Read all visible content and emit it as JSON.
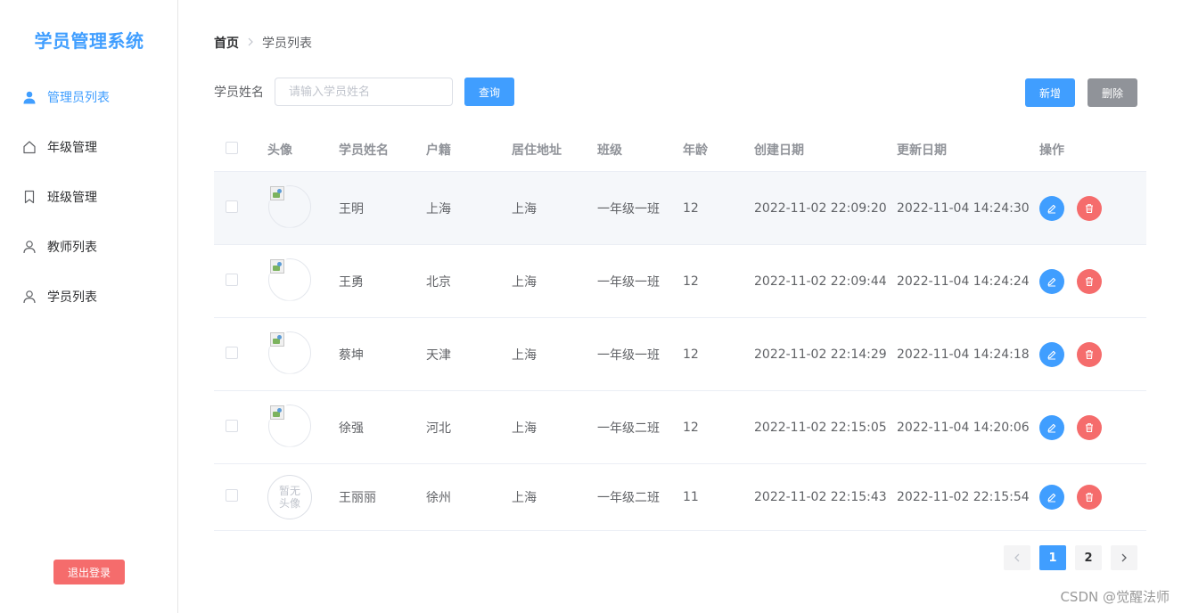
{
  "app": {
    "title": "学员管理系统"
  },
  "sidebar": {
    "items": [
      {
        "label": "管理员列表",
        "icon": "user-filled-icon",
        "active": true
      },
      {
        "label": "年级管理",
        "icon": "house-icon",
        "active": false
      },
      {
        "label": "班级管理",
        "icon": "bookmark-icon",
        "active": false
      },
      {
        "label": "教师列表",
        "icon": "user-icon",
        "active": false
      },
      {
        "label": "学员列表",
        "icon": "user-icon",
        "active": false
      }
    ],
    "logout_label": "退出登录"
  },
  "breadcrumb": {
    "home": "首页",
    "current": "学员列表"
  },
  "search": {
    "label": "学员姓名",
    "placeholder": "请输入学员姓名",
    "value": "",
    "query_label": "查询"
  },
  "toolbar": {
    "add_label": "新增",
    "delete_label": "删除"
  },
  "table": {
    "headers": {
      "avatar": "头像",
      "name": "学员姓名",
      "hometown": "户籍",
      "address": "居住地址",
      "class": "班级",
      "age": "年龄",
      "created": "创建日期",
      "updated": "更新日期",
      "actions": "操作"
    },
    "rows": [
      {
        "name": "王明",
        "hometown": "上海",
        "address": "上海",
        "class": "一年级一班",
        "age": "12",
        "created": "2022-11-02 22:09:20",
        "updated": "2022-11-04 14:24:30",
        "avatar": "broken-image",
        "avatar_text": ""
      },
      {
        "name": "王勇",
        "hometown": "北京",
        "address": "上海",
        "class": "一年级一班",
        "age": "12",
        "created": "2022-11-02 22:09:44",
        "updated": "2022-11-04 14:24:24",
        "avatar": "broken-image",
        "avatar_text": ""
      },
      {
        "name": "蔡坤",
        "hometown": "天津",
        "address": "上海",
        "class": "一年级一班",
        "age": "12",
        "created": "2022-11-02 22:14:29",
        "updated": "2022-11-04 14:24:18",
        "avatar": "broken-image",
        "avatar_text": ""
      },
      {
        "name": "徐强",
        "hometown": "河北",
        "address": "上海",
        "class": "一年级二班",
        "age": "12",
        "created": "2022-11-02 22:15:05",
        "updated": "2022-11-04 14:20:06",
        "avatar": "broken-image",
        "avatar_text": ""
      },
      {
        "name": "王丽丽",
        "hometown": "徐州",
        "address": "上海",
        "class": "一年级二班",
        "age": "11",
        "created": "2022-11-02 22:15:43",
        "updated": "2022-11-02 22:15:54",
        "avatar": "placeholder",
        "avatar_text": "暂无\n头像"
      }
    ]
  },
  "pagination": {
    "pages": [
      "1",
      "2"
    ],
    "current": "1",
    "prev_icon": "chevron-left-icon",
    "next_icon": "chevron-right-icon"
  },
  "watermark": "CSDN @觉醒法师",
  "colors": {
    "primary": "#409eff",
    "danger": "#f56c6c",
    "info": "#909399"
  }
}
